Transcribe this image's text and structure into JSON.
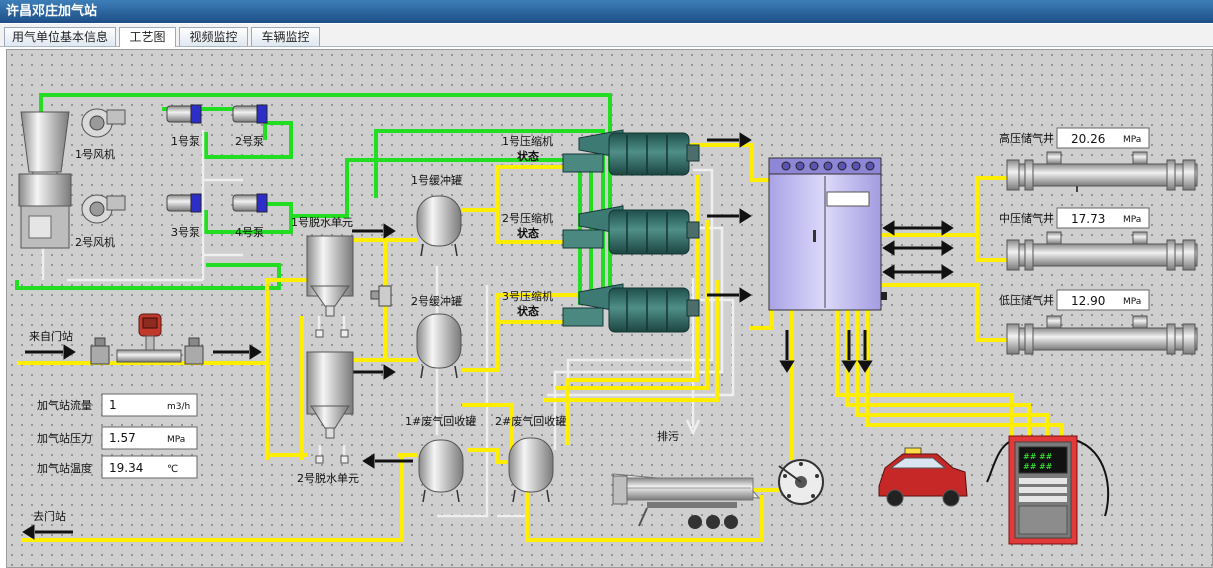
{
  "window": {
    "title": "许昌邓庄加气站"
  },
  "tabs": [
    {
      "label": "用气单位基本信息"
    },
    {
      "label": "工艺图"
    },
    {
      "label": "视频监控"
    },
    {
      "label": "车辆监控"
    }
  ],
  "diagram": {
    "fan1_label": "1号风机",
    "fan2_label": "2号风机",
    "pump1_label": "1号泵",
    "pump2_label": "2号泵",
    "pump3_label": "3号泵",
    "pump4_label": "4号泵",
    "dehydration1_label": "1号脱水单元",
    "dehydration2_label": "2号脱水单元",
    "buffer1_label": "1号缓冲罐",
    "buffer2_label": "2号缓冲罐",
    "compressor1_label": "1号压缩机",
    "compressor2_label": "2号压缩机",
    "compressor3_label": "3号压缩机",
    "compressor1_status": "状态",
    "compressor2_status": "状态",
    "compressor3_status": "状态",
    "recovery1_label": "1#废气回收罐",
    "recovery2_label": "2#废气回收罐",
    "vent_label": "排污",
    "from_station_label": "来自门站",
    "to_station_label": "去门站",
    "high_storage_label": "高压储气井",
    "mid_storage_label": "中压储气井",
    "low_storage_label": "低压储气井",
    "dispenser_digits": "## ##"
  },
  "readings": {
    "high_pressure": {
      "value": "20.26",
      "unit": "MPa"
    },
    "mid_pressure": {
      "value": "17.73",
      "unit": "MPa"
    },
    "low_pressure": {
      "value": "12.90",
      "unit": "MPa"
    },
    "flow": {
      "label": "加气站流量",
      "value": "1",
      "unit": "m3/h"
    },
    "pressure": {
      "label": "加气站压力",
      "value": "1.57",
      "unit": "MPa"
    },
    "temperature": {
      "label": "加气站温度",
      "value": "19.34",
      "unit": "℃"
    }
  },
  "colors": {
    "gas_line": "#ffee00",
    "water_line": "#22dd22",
    "return_line": "#e8e8e8",
    "panel": "#c6c2f0",
    "compressor": "#2f6b66"
  }
}
